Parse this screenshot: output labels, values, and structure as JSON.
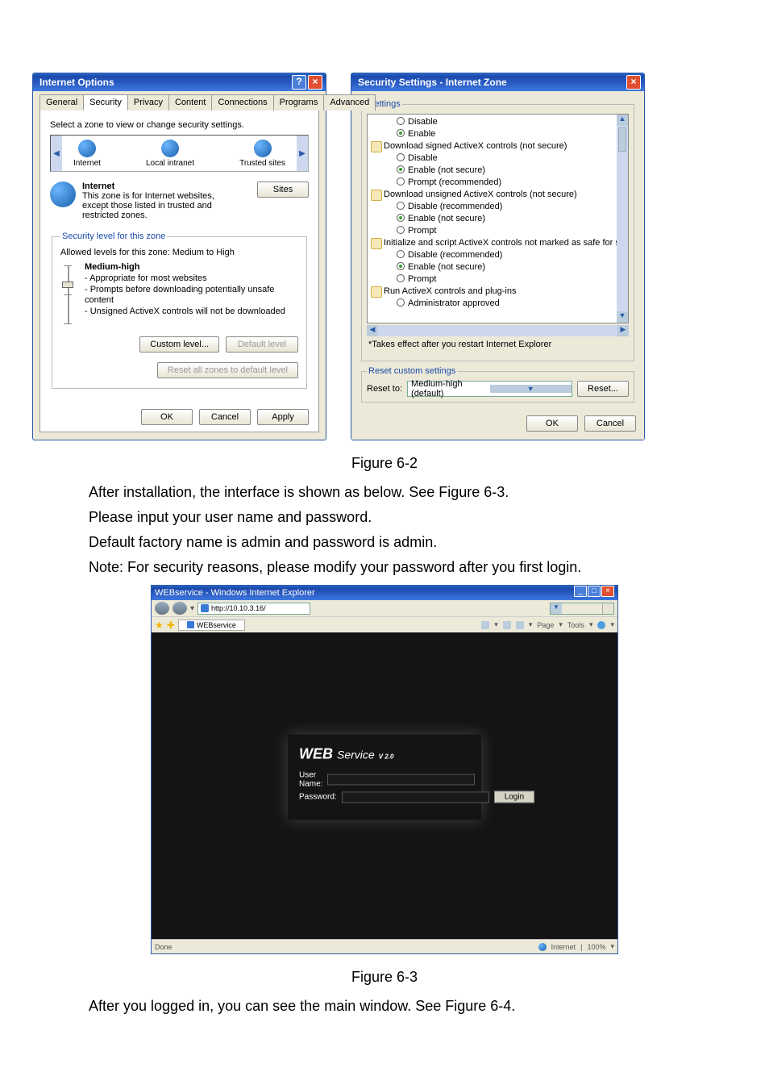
{
  "internetOptions": {
    "title": "Internet Options",
    "tabs": [
      "General",
      "Security",
      "Privacy",
      "Content",
      "Connections",
      "Programs",
      "Advanced"
    ],
    "activeTab": 1,
    "selectZoneText": "Select a zone to view or change security settings.",
    "zones": [
      "Internet",
      "Local intranet",
      "Trusted sites"
    ],
    "sitesLabel": "Sites",
    "zoneTitle": "Internet",
    "zoneDesc1": "This zone is for Internet websites,",
    "zoneDesc2": "except those listed in trusted and",
    "zoneDesc3": "restricted zones.",
    "secLegend": "Security level for this zone",
    "allowed": "Allowed levels for this zone: Medium to High",
    "levelName": "Medium-high",
    "levelB1": "- Appropriate for most websites",
    "levelB2": "- Prompts before downloading potentially unsafe content",
    "levelB3": "- Unsigned ActiveX controls will not be downloaded",
    "customLevel": "Custom level...",
    "defaultLevel": "Default level",
    "resetAll": "Reset all zones to default level",
    "ok": "OK",
    "cancel": "Cancel",
    "apply": "Apply"
  },
  "secSettings": {
    "title": "Security Settings - Internet Zone",
    "settingsLegend": "Settings",
    "items": [
      {
        "t": "o",
        "sel": false,
        "label": "Disable"
      },
      {
        "t": "o",
        "sel": true,
        "label": "Enable"
      },
      {
        "t": "g",
        "label": "Download signed ActiveX controls (not secure)"
      },
      {
        "t": "o",
        "sel": false,
        "label": "Disable"
      },
      {
        "t": "o",
        "sel": true,
        "label": "Enable (not secure)"
      },
      {
        "t": "o",
        "sel": false,
        "label": "Prompt (recommended)"
      },
      {
        "t": "g",
        "label": "Download unsigned ActiveX controls (not secure)"
      },
      {
        "t": "o",
        "sel": false,
        "label": "Disable (recommended)"
      },
      {
        "t": "o",
        "sel": true,
        "label": "Enable (not secure)"
      },
      {
        "t": "o",
        "sel": false,
        "label": "Prompt"
      },
      {
        "t": "g",
        "label": "Initialize and script ActiveX controls not marked as safe for sc"
      },
      {
        "t": "o",
        "sel": false,
        "label": "Disable (recommended)"
      },
      {
        "t": "o",
        "sel": true,
        "label": "Enable (not secure)"
      },
      {
        "t": "o",
        "sel": false,
        "label": "Prompt"
      },
      {
        "t": "g",
        "label": "Run ActiveX controls and plug-ins"
      },
      {
        "t": "o",
        "sel": false,
        "label": "Administrator approved"
      }
    ],
    "note": "*Takes effect after you restart Internet Explorer",
    "resetLegend": "Reset custom settings",
    "resetTo": "Reset to:",
    "resetCombo": "Medium-high (default)",
    "resetBtn": "Reset...",
    "ok": "OK",
    "cancel": "Cancel"
  },
  "figure62": "Figure 6-2",
  "bodyText": {
    "p1": "After installation, the interface is shown as below. See Figure 6-3.",
    "p2": "Please input your user name and password.",
    "p3": "Default factory name is admin and password is admin.",
    "p4": "Note: For security reasons, please modify your password after you first login."
  },
  "browser": {
    "title": "WEBservice - Windows Internet Explorer",
    "url": "http://10.10.3.16/",
    "tab": "WEBservice",
    "toolsPage": "Page",
    "toolsTools": "Tools",
    "logo1": "WEB",
    "logo2": "Service",
    "logo3": "V 2.0",
    "userLabel": "User Name:",
    "passLabel": "Password:",
    "loginBtn": "Login",
    "statusLeft": "Done",
    "statusZone": "Internet",
    "statusZoom": "100%"
  },
  "figure63": "Figure 6-3",
  "afterLogin": "After you logged in, you can see the main window. See Figure 6-4."
}
